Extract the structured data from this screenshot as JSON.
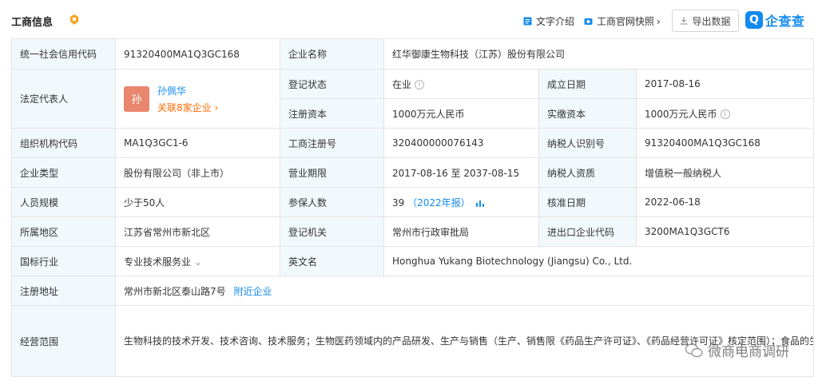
{
  "header": {
    "title": "工商信息",
    "text_intro": "文字介绍",
    "snapshot": "工商官网快照",
    "export": "导出数据",
    "logo_text": "企查查",
    "logo_char": "Q"
  },
  "rows": {
    "credit_code": {
      "label": "统一社会信用代码",
      "value": "91320400MA1Q3GC168"
    },
    "company_name": {
      "label": "企业名称",
      "value": "红华御康生物科技（江苏）股份有限公司"
    },
    "legal_rep": {
      "label": "法定代表人",
      "name": "孙佩华",
      "avatar": "孙",
      "related": "关联8家企业"
    },
    "reg_status": {
      "label": "登记状态",
      "value": "在业"
    },
    "founded": {
      "label": "成立日期",
      "value": "2017-08-16"
    },
    "reg_capital": {
      "label": "注册资本",
      "value": "1000万元人民币"
    },
    "paid_capital": {
      "label": "实缴资本",
      "value": "1000万元人民币"
    },
    "org_code": {
      "label": "组织机构代码",
      "value": "MA1Q3GC1-6"
    },
    "biz_reg_no": {
      "label": "工商注册号",
      "value": "320400000076143"
    },
    "taxpayer_id": {
      "label": "纳税人识别号",
      "value": "91320400MA1Q3GC168"
    },
    "company_type": {
      "label": "企业类型",
      "value": "股份有限公司（非上市）"
    },
    "biz_term": {
      "label": "营业期限",
      "value": "2017-08-16 至 2037-08-15"
    },
    "taxpayer_qual": {
      "label": "纳税人资质",
      "value": "增值税一般纳税人"
    },
    "staff_size": {
      "label": "人员规模",
      "value": "少于50人"
    },
    "insured": {
      "label": "参保人数",
      "value": "39",
      "year": "（2022年报）"
    },
    "approve_date": {
      "label": "核准日期",
      "value": "2022-06-18"
    },
    "region": {
      "label": "所属地区",
      "value": "江苏省常州市新北区"
    },
    "reg_authority": {
      "label": "登记机关",
      "value": "常州市行政审批局"
    },
    "ie_code": {
      "label": "进出口企业代码",
      "value": "3200MA1Q3GCT6"
    },
    "industry": {
      "label": "国标行业",
      "value": "专业技术服务业"
    },
    "english_name": {
      "label": "英文名",
      "value": "Honghua Yukang Biotechnology (Jiangsu) Co., Ltd."
    },
    "reg_address": {
      "label": "注册地址",
      "value": "常州市新北区泰山路7号",
      "nearby": "附近企业"
    },
    "scope": {
      "label": "经营范围",
      "value": "生物科技的技术开发、技术咨询、技术服务；生物医药领域内的产品研发、生产与销售（生产、销售限《药品生产许可证》、《药品经营许可证》核定范围）；食品的生产、销售（限《食品生产许可证》、《食品经营许可证》核定范围）；农副产品的收购、加工及销售；自营和代理各类商品及技术的进出口业务（国家限定企业经营或禁止进出口的商品和技术除外）（依法须经批准的项目，经相关部门批准后方可开展经营活动） 一般项目：化妆品零售；（除依法须经批准的项目外，凭营业执照依法自主开展经营活动）"
    }
  },
  "watermark": "微商电商调研",
  "colors": {
    "accent": "#128bed",
    "label_bg": "#f2f9fc",
    "related": "#ff6a00",
    "avatar": "#e8876d"
  }
}
